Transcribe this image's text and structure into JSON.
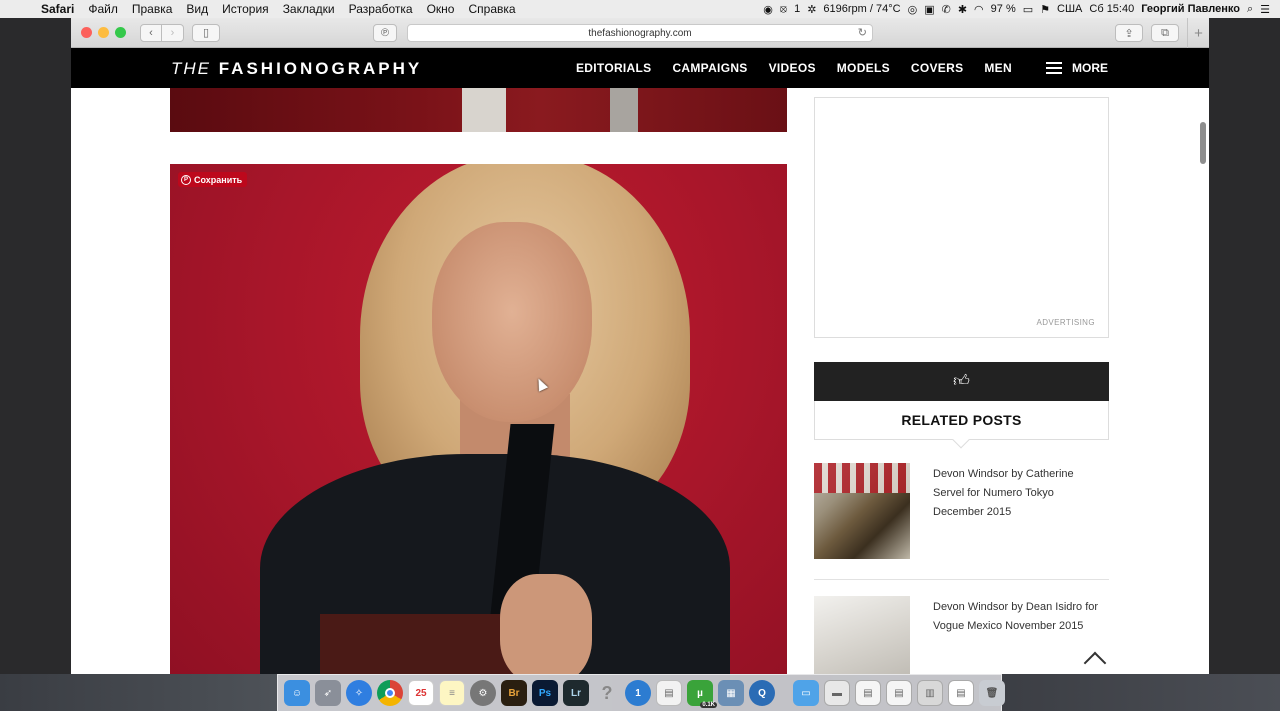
{
  "menubar": {
    "apple": "",
    "items": [
      "Safari",
      "Файл",
      "Правка",
      "Вид",
      "История",
      "Закладки",
      "Разработка",
      "Окно",
      "Справка"
    ],
    "status_fan": "6196rpm / 74°C",
    "status_count": "1",
    "battery": "97 %",
    "input_source": "США",
    "clock": "Сб 15:40",
    "user": "Георгий Павленко"
  },
  "browser": {
    "url": "thefashionography.com"
  },
  "site": {
    "logo_the": "THE",
    "logo_brand": "FASHIONOGRAPHY",
    "nav": [
      "EDITORIALS",
      "CAMPAIGNS",
      "VIDEOS",
      "MODELS",
      "COVERS",
      "MEN"
    ],
    "more_label": "MORE"
  },
  "photo": {
    "save_label": "Сохранить"
  },
  "sidebar": {
    "ad_label": "ADVERTISING",
    "related_title": "RELATED POSTS",
    "posts": [
      {
        "title": "Devon Windsor by Catherine Servel for Numero Tokyo December 2015"
      },
      {
        "title": "Devon Windsor by Dean Isidro for Vogue Mexico November 2015"
      }
    ]
  },
  "dock": {
    "calendar_day": "25",
    "bridge": "Br",
    "photoshop": "Ps",
    "lightroom": "Lr",
    "onepassword": "1",
    "utorrent_badge": "0.1K"
  },
  "colors": {
    "site_header_bg": "#000000",
    "photo_red": "#a8162a",
    "pinterest_red": "#bd081c"
  }
}
